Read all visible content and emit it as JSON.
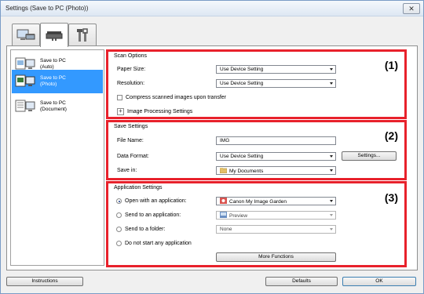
{
  "window": {
    "title": "Settings (Save to PC (Photo))",
    "close_glyph": "✕"
  },
  "tabs": [
    {
      "icon": "scanner-monitor-icon",
      "active": false
    },
    {
      "icon": "scanner-icon",
      "active": true
    },
    {
      "icon": "tools-icon",
      "active": false
    }
  ],
  "left_list": {
    "items": [
      {
        "label_line1": "Save to PC",
        "label_line2": "(Auto)",
        "selected": false
      },
      {
        "label_line1": "Save to PC",
        "label_line2": "(Photo)",
        "selected": true
      },
      {
        "label_line1": "Save to PC",
        "label_line2": "(Document)",
        "selected": false
      }
    ]
  },
  "scan_options": {
    "title": "Scan Options",
    "number": "(1)",
    "paper_size_label": "Paper Size:",
    "paper_size_value": "Use Device Setting",
    "resolution_label": "Resolution:",
    "resolution_value": "Use Device Setting",
    "compress_label": "Compress scanned images upon transfer",
    "compress_checked": false,
    "image_processing_label": "Image Processing Settings",
    "expander_glyph": "+"
  },
  "save_settings": {
    "title": "Save Settings",
    "number": "(2)",
    "file_name_label": "File Name:",
    "file_name_value": "IMG",
    "data_format_label": "Data Format:",
    "data_format_value": "Use Device Setting",
    "settings_button": "Settings...",
    "save_in_label": "Save in:",
    "save_in_value": "My Documents"
  },
  "application_settings": {
    "title": "Application Settings",
    "number": "(3)",
    "open_with_label": "Open with an application:",
    "open_with_value": "Canon My Image Garden",
    "send_to_app_label": "Send to an application:",
    "send_to_app_value": "Preview",
    "send_to_folder_label": "Send to a folder:",
    "send_to_folder_value": "None",
    "do_not_start_label": "Do not start any application",
    "more_functions_button": "More Functions",
    "selected_option": "open_with"
  },
  "footer": {
    "instructions_button": "Instructions",
    "defaults_button": "Defaults",
    "ok_button": "OK"
  },
  "colors": {
    "group_border": "#e8212b",
    "selection": "#3399ff"
  }
}
